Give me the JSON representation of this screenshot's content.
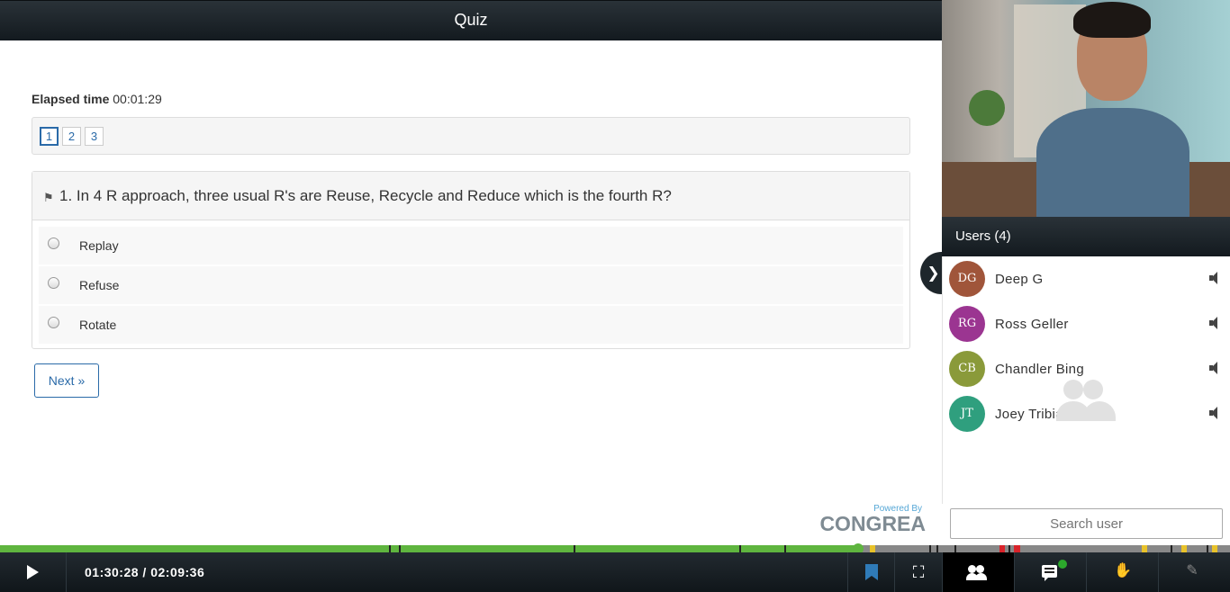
{
  "header": {
    "title": "Quiz"
  },
  "quiz": {
    "elapsed_label": "Elapsed time",
    "elapsed_value": "00:01:29",
    "pages": [
      "1",
      "2",
      "3"
    ],
    "active_page": "1",
    "question": "1. In 4 R approach, three usual R's are Reuse, Recycle and Reduce which is the fourth R?",
    "options": [
      "Replay",
      "Refuse",
      "Rotate"
    ],
    "next_label": "Next »",
    "powered_by": "Powered By",
    "brand": "CONGREA"
  },
  "users": {
    "title": "Users (4)",
    "list": [
      {
        "initials": "DG",
        "name": "Deep G",
        "color": "#a0553a"
      },
      {
        "initials": "RG",
        "name": "Ross Geller",
        "color": "#9b3591"
      },
      {
        "initials": "CB",
        "name": "Chandler Bing",
        "color": "#8a9a3a"
      },
      {
        "initials": "JT",
        "name": "Joey Tribianni",
        "color": "#2f9f7e"
      }
    ],
    "search_placeholder": "Search user"
  },
  "player": {
    "time": "01:30:28 / 02:09:36",
    "progress_fraction": 0.698,
    "colors": {
      "played": "#5fb53f",
      "unplayed": "#888888",
      "accent": "#2f7bb8"
    }
  },
  "icons": {
    "play": "play-icon",
    "bookmark": "bookmark-icon",
    "fullscreen": "fullscreen-icon",
    "users": "users-icon",
    "chat": "chat-icon",
    "raise_hand": "raise-hand-icon",
    "notes": "notes-icon",
    "toggle": "chevron-right-icon",
    "mute": "speaker-icon"
  }
}
